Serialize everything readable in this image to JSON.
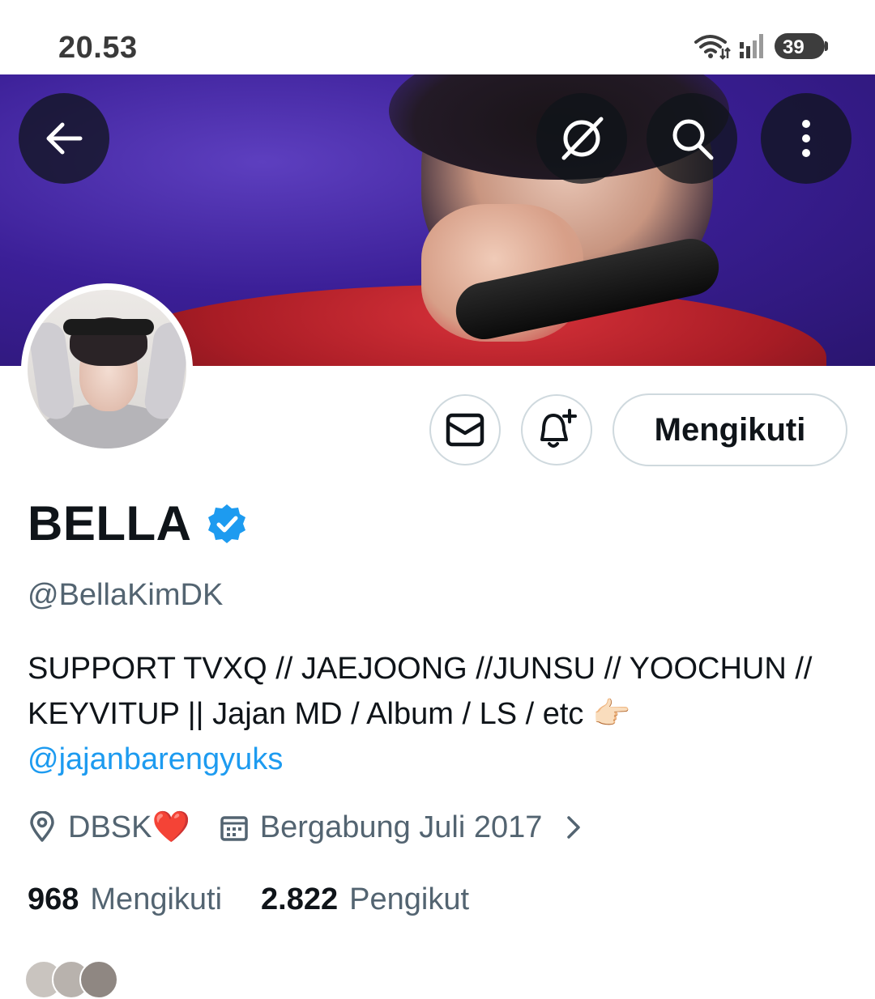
{
  "status_bar": {
    "time": "20.53",
    "battery": "39",
    "icons": [
      "wifi-icon",
      "signal-icon",
      "battery-icon"
    ]
  },
  "header": {
    "back_icon": "arrow-left-icon",
    "actions": [
      "grok-icon",
      "search-icon",
      "more-vertical-icon"
    ]
  },
  "profile": {
    "name": "BELLA",
    "handle": "@BellaKimDK",
    "bio_text": "SUPPORT TVXQ // JAEJOONG //JUNSU // YOOCHUN // KEYVITUP || Jajan MD / Album / LS / etc 👉🏻 ",
    "bio_link": "@jajanbarengyuks",
    "location": "DBSK❤️",
    "joined": "Bergabung Juli 2017",
    "following_count": "968",
    "following_label": "Mengikuti",
    "followers_count": "2.822",
    "followers_label": "Pengikut"
  },
  "actions": {
    "message_icon": "mail-icon",
    "notify_icon": "bell-plus-icon",
    "follow_label": "Mengikuti"
  },
  "colors": {
    "accent": "#1d9bf0",
    "verified": "#1d9bf0",
    "muted": "#536471",
    "text": "#0f1419"
  }
}
